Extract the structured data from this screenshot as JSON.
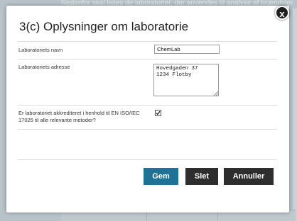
{
  "background": {
    "top_text": "Nedenfor skal listes de laboratorier, der anvendes til analyse af brændsler"
  },
  "dialog": {
    "title": "3(c) Oplysninger om laboratorie",
    "close_glyph": "x",
    "fields": {
      "name": {
        "label": "Laboratoriets navn",
        "value": "ChemLab"
      },
      "address": {
        "label": "Laboratoriets adresse",
        "value": "Hovedgaden 37\n1234 Flotby"
      },
      "accredited": {
        "label": "Er laboratoriet akkrediteret i henhold til EN ISO/IEC 17025 til alle relevante metoder?",
        "checked": true
      }
    },
    "buttons": {
      "save": "Gem",
      "delete": "Slet",
      "cancel": "Annuller"
    }
  },
  "colors": {
    "primary_button": "#1e7296",
    "dark_button": "#2e2e2e",
    "backdrop": "#b8c3c9"
  },
  "icons": {
    "close": "close-icon",
    "checkmark": "checkmark-icon",
    "resize": "resize-grip-icon"
  }
}
